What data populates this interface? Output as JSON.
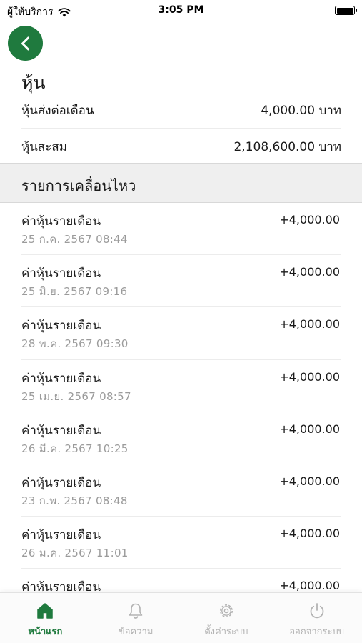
{
  "status_bar": {
    "carrier": "ผู้ให้บริการ",
    "time": "3:05 PM"
  },
  "header": {
    "title": "หุ้น"
  },
  "summary": [
    {
      "label": "หุ้นส่งต่อเดือน",
      "value": "4,000.00 บาท"
    },
    {
      "label": "หุ้นสะสม",
      "value": "2,108,600.00 บาท"
    }
  ],
  "movements": {
    "title": "รายการเคลื่อนไหว",
    "items": [
      {
        "label": "ค่าหุ้นรายเดือน",
        "date": "25 ก.ค. 2567 08:44",
        "amount": "+4,000.00"
      },
      {
        "label": "ค่าหุ้นรายเดือน",
        "date": "25 มิ.ย. 2567 09:16",
        "amount": "+4,000.00"
      },
      {
        "label": "ค่าหุ้นรายเดือน",
        "date": "28 พ.ค. 2567 09:30",
        "amount": "+4,000.00"
      },
      {
        "label": "ค่าหุ้นรายเดือน",
        "date": "25 เม.ย. 2567 08:57",
        "amount": "+4,000.00"
      },
      {
        "label": "ค่าหุ้นรายเดือน",
        "date": "26 มี.ค. 2567 10:25",
        "amount": "+4,000.00"
      },
      {
        "label": "ค่าหุ้นรายเดือน",
        "date": "23 ก.พ. 2567 08:48",
        "amount": "+4,000.00"
      },
      {
        "label": "ค่าหุ้นรายเดือน",
        "date": "26 ม.ค. 2567 11:01",
        "amount": "+4,000.00"
      },
      {
        "label": "ค่าหุ้นรายเดือน",
        "date": "",
        "amount": "+4,000.00"
      }
    ]
  },
  "tabs": [
    {
      "label": "หน้าแรก",
      "icon": "home-icon",
      "active": true
    },
    {
      "label": "ข้อความ",
      "icon": "bell-icon",
      "active": false
    },
    {
      "label": "ตั้งค่าระบบ",
      "icon": "gear-icon",
      "active": false
    },
    {
      "label": "ออกจากระบบ",
      "icon": "power-icon",
      "active": false
    }
  ],
  "colors": {
    "accent": "#1f7a3e",
    "inactive_tab": "#b3b3b3",
    "date_text": "#9b9b9b",
    "section_bg": "#efefef"
  }
}
